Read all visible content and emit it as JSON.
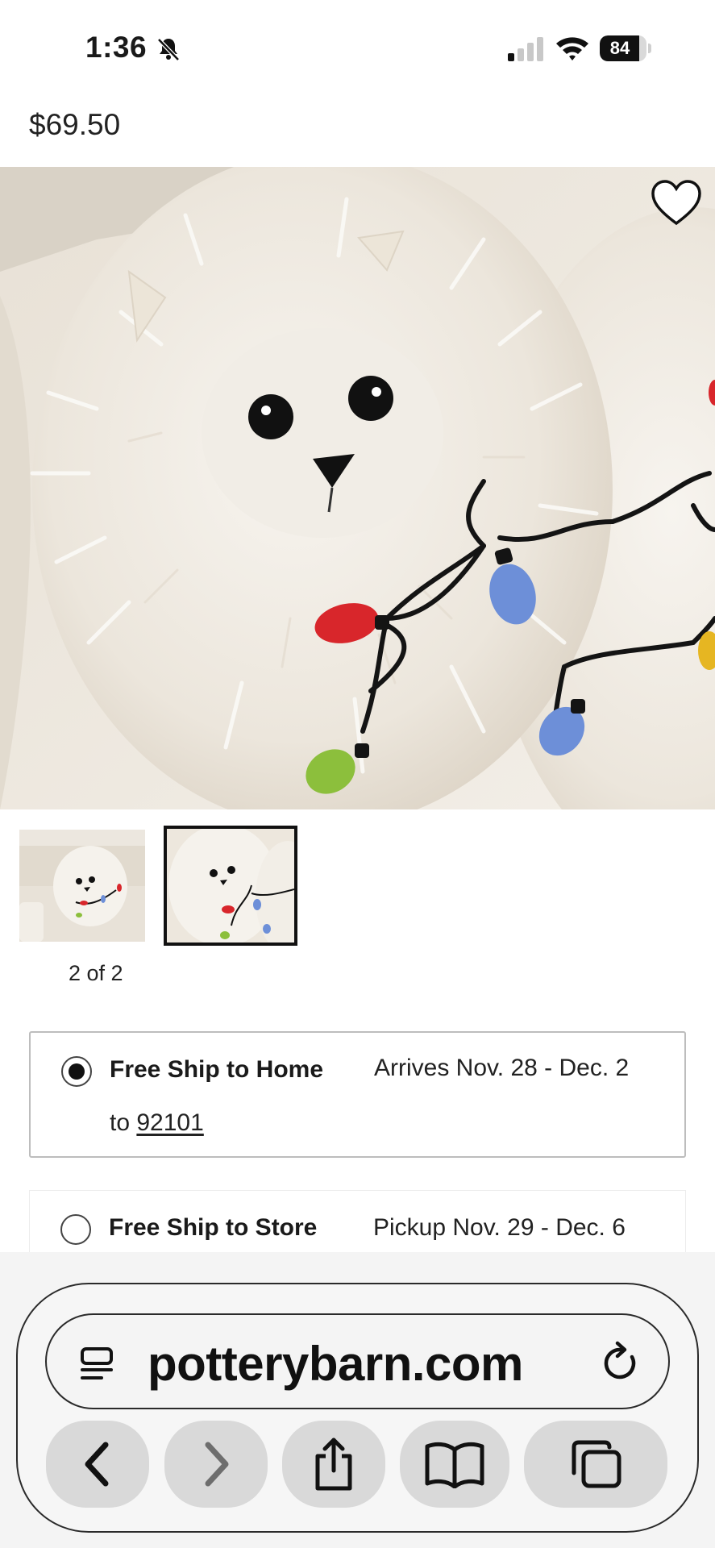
{
  "status_bar": {
    "time": "1:36",
    "battery_percent": "84",
    "battery_level": 0.84,
    "icons": [
      "bell-muted-icon",
      "cellular-signal-icon",
      "wifi-icon",
      "battery-icon"
    ]
  },
  "product": {
    "price": "$69.50",
    "favorite_icon": "heart-outline-icon"
  },
  "gallery": {
    "counter": "2 of 2",
    "selected_index": 2,
    "thumbnails": [
      "pillow-on-sofa-thumbnail",
      "pillow-closeup-thumbnail"
    ]
  },
  "shipping": {
    "options": [
      {
        "title": "Free Ship to Home",
        "date_text": "Arrives Nov. 28 - Dec. 2",
        "to_prefix": "to",
        "zip": "92101",
        "selected": true
      },
      {
        "title": "Free Ship to Store",
        "date_text": "Pickup Nov. 29 - Dec. 6",
        "selected": false
      }
    ]
  },
  "browser": {
    "url": "potterybarn.com",
    "buttons": [
      "back-icon",
      "forward-icon",
      "share-icon",
      "bookmarks-icon",
      "tabs-icon"
    ]
  },
  "colors": {
    "text": "#1a1a1a",
    "border": "#bdbdbd",
    "toolbar_button": "#d9d9d9",
    "bulb_red": "#d8262b",
    "bulb_blue": "#6d8fd8",
    "bulb_green": "#8cbf3c",
    "bulb_yellow": "#e6b622"
  }
}
